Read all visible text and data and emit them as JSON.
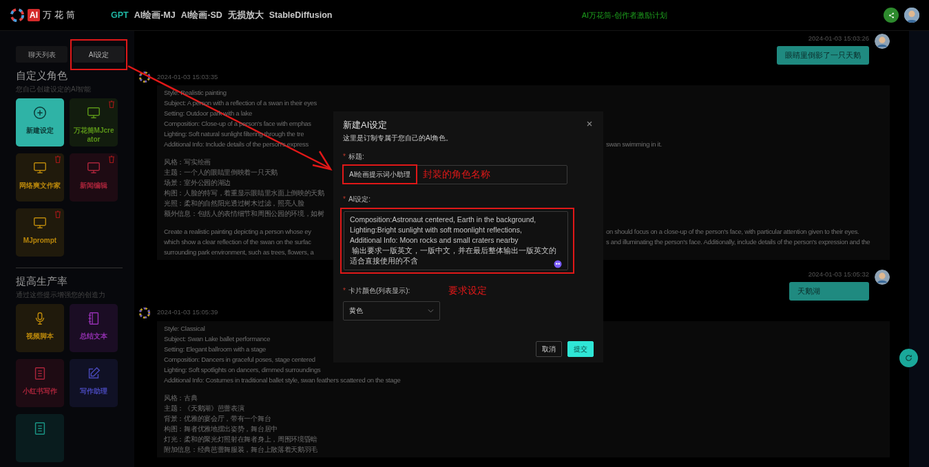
{
  "header": {
    "logo_badge": "AI",
    "logo_text": "万花筒",
    "nav": [
      {
        "label": "GPT",
        "selected": true
      },
      {
        "label": "AI绘画-MJ",
        "selected": false
      },
      {
        "label": "AI绘画-SD",
        "selected": false
      },
      {
        "label": "无损放大",
        "selected": false
      },
      {
        "label": "StableDiffusion",
        "selected": false
      }
    ],
    "promo": "AI万花筒-创作者激励计划"
  },
  "sidebar": {
    "tabs": [
      {
        "label": "聊天列表",
        "selected": false
      },
      {
        "label": "AI设定",
        "selected": true
      }
    ],
    "sections": [
      {
        "title": "自定义角色",
        "subtitle": "您自己创建设定的AI智能",
        "cards": [
          {
            "kind": "new",
            "label": "新建设定",
            "color": "#2fb3a6",
            "deletable": false
          },
          {
            "kind": "monitor",
            "label": "万花筒MJcreator",
            "color": "#5a9418",
            "deletable": true
          },
          {
            "kind": "monitor",
            "label": "网络爽文作家",
            "color": "#b8860b",
            "deletable": true
          },
          {
            "kind": "monitor",
            "label": "新闻编辑",
            "color": "#a8243a",
            "deletable": true
          },
          {
            "kind": "monitor",
            "label": "MJprompt",
            "color": "#b8860b",
            "deletable": true
          }
        ]
      },
      {
        "title": "提高生产率",
        "subtitle": "通过这些提示增强您的创造力",
        "cards": [
          {
            "kind": "mic",
            "label": "视频脚本",
            "color": "#b8860b",
            "deletable": false
          },
          {
            "kind": "notebook",
            "label": "总结文本",
            "color": "#9330b0",
            "deletable": false
          },
          {
            "kind": "document",
            "label": "小红书写作",
            "color": "#a8243a",
            "deletable": false
          },
          {
            "kind": "edit",
            "label": "写作助理",
            "color": "#4848b8",
            "deletable": false
          },
          {
            "kind": "document",
            "color": "#1a9484",
            "deletable": false
          }
        ]
      }
    ]
  },
  "chat": {
    "messages": [
      {
        "kind": "user",
        "time": "2024-01-03 15:03:26",
        "text": "眼睛里倒影了一只天鹅"
      },
      {
        "kind": "assistant",
        "time": "2024-01-03 15:03:35",
        "paragraphs": [
          [
            {
              "left": "Style: Realistic painting"
            },
            {
              "left": "Subject: A person with a reflection of a swan in their eyes"
            },
            {
              "left": "Setting: Outdoor park with a lake"
            },
            {
              "left": "Composition: Close-up of a person's face with emphas"
            },
            {
              "left": "Lighting: Soft natural sunlight filtering through the tre"
            },
            {
              "left": "Additional Info: Include details of the person's express",
              "right": "swan swimming in it."
            }
          ],
          [
            {
              "left": "风格：写实绘画"
            },
            {
              "left": "主题：一个人的眼睛里倒映着一只天鹅"
            },
            {
              "left": "场景：室外公园的湖边"
            },
            {
              "left": "构图：人脸的特写，着重显示眼睛里水面上倒映的天鹅"
            },
            {
              "left": "光照：柔和的自然阳光透过树木过滤，照亮人脸"
            },
            {
              "left": "额外信息：包括人的表情细节和周围公园的环境，如树"
            }
          ],
          [
            {
              "left": "Create a realistic painting depicting a person whose ey",
              "right": "on should focus on a close-up of the person's face, with particular attention given to their eyes."
            },
            {
              "left": "which show a clear reflection of the swan on the surfac",
              "right": "s and illuminating the person's face. Additionally, include details of the person's expression and the"
            },
            {
              "left": "surrounding park environment, such as trees, flowers, a"
            }
          ]
        ]
      },
      {
        "kind": "user",
        "time": "2024-01-03 15:05:32",
        "text": "天鹅湖"
      },
      {
        "kind": "assistant",
        "time": "2024-01-03 15:05:39",
        "paragraphs": [
          [
            {
              "left": "Style: Classical"
            },
            {
              "left": "Subject: Swan Lake ballet performance"
            },
            {
              "left": "Setting: Elegant ballroom with a stage"
            },
            {
              "left": "Composition: Dancers in graceful poses, stage centered"
            },
            {
              "left": "Lighting: Soft spotlights on dancers, dimmed surroundings"
            },
            {
              "left": "Additional Info: Costumes in traditional ballet style, swan feathers scattered on the stage"
            }
          ],
          [
            {
              "left": "风格：古典"
            },
            {
              "left": "主题：《天鹅湖》芭蕾表演"
            },
            {
              "left": "背景：优雅的宴会厅，带有一个舞台"
            },
            {
              "left": "构图：舞者优雅地摆出姿势，舞台居中"
            },
            {
              "left": "灯光：柔和的聚光灯照射在舞者身上，周围环境昏暗"
            },
            {
              "left": "附加信息：经典芭蕾舞服装，舞台上散落着天鹅羽毛"
            }
          ]
        ]
      }
    ]
  },
  "modal": {
    "title": "新建AI设定",
    "subtitle": "这里是订制专属于您自己的AI角色。",
    "fields": [
      {
        "kind": "input",
        "mark": "*",
        "label": "标题:",
        "value": "AI绘画提示词小助理"
      },
      {
        "kind": "textarea",
        "mark": "*",
        "label": "AI设定:",
        "value": "Composition:Astronaut centered, Earth in the background,\nLighting:Bright sunlight with soft moonlight reflections,\nAdditional Info: Moon rocks and small craters nearby\n 输出要求一版英文，一版中文，并在最后整体输出一版英文的适合直接使用的不含"
      },
      {
        "kind": "select",
        "mark": "*",
        "label": "卡片颜色(列表显示):",
        "value": "黄色"
      }
    ],
    "buttons": [
      {
        "kind": "secondary",
        "label": "取消"
      },
      {
        "kind": "primary",
        "label": "提交"
      }
    ]
  },
  "annotations": {
    "notes": [
      {
        "kind": "title",
        "text": "封装的角色名称"
      },
      {
        "kind": "setting",
        "text": "要求设定"
      }
    ]
  }
}
